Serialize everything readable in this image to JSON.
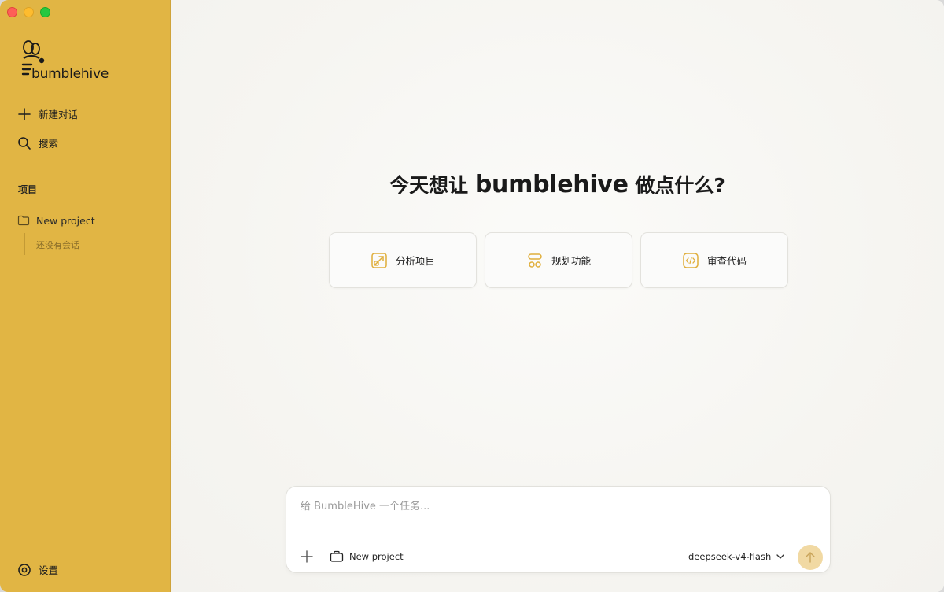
{
  "sidebar": {
    "brand": "bumblehive",
    "new_chat": "新建对话",
    "search": "搜索",
    "section_title": "项目",
    "project_name": "New project",
    "project_empty": "还没有会话",
    "settings": "设置"
  },
  "main": {
    "headline_before": "今天想让 ",
    "headline_brand": "bumblehive",
    "headline_after": " 做点什么?",
    "cards": [
      {
        "label": "分析项目",
        "icon": "analyze-icon"
      },
      {
        "label": "规划功能",
        "icon": "plan-icon"
      },
      {
        "label": "审查代码",
        "icon": "code-icon"
      }
    ]
  },
  "composer": {
    "placeholder": "给 BumbleHive 一个任务...",
    "value": "",
    "project_label": "New project",
    "model": "deepseek-v4-flash"
  },
  "colors": {
    "sidebar_bg": "#e1b544",
    "accent": "#e0ae3a",
    "send_button": "#f1d9a3",
    "main_bg": "#f6f5f1"
  }
}
